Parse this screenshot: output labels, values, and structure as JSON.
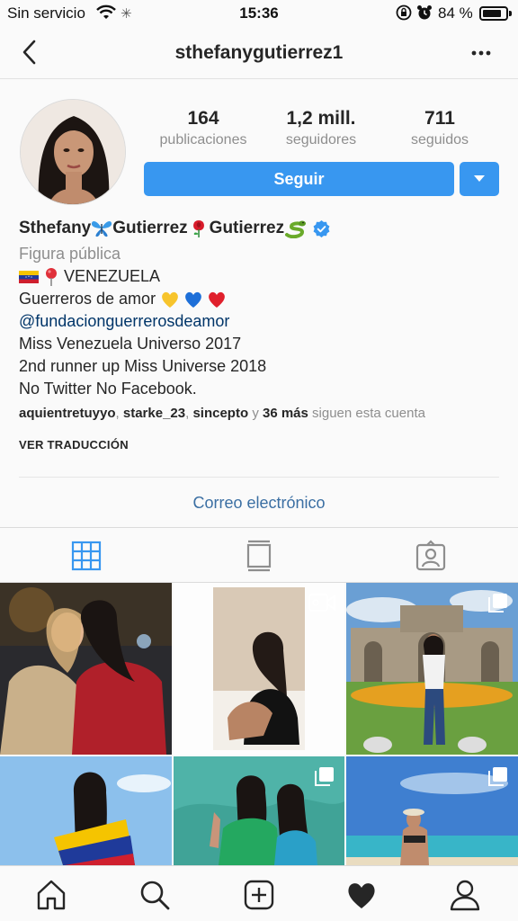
{
  "status_bar": {
    "carrier": "Sin servicio",
    "time": "15:36",
    "battery": "84 %",
    "battery_level": 0.84
  },
  "header": {
    "username": "sthefanygutierrez1",
    "back_icon": "chevron-left-icon",
    "more_icon": "more-horizontal-icon"
  },
  "profile": {
    "stats": [
      {
        "value": "164",
        "label": "publicaciones"
      },
      {
        "value": "1,2 mill.",
        "label": "seguidores"
      },
      {
        "value": "711",
        "label": "seguidos"
      }
    ],
    "follow_label": "Seguir",
    "accent_color": "#3897f0"
  },
  "bio": {
    "name_parts": [
      "Sthefany",
      "Gutierrez",
      "Gutierrez"
    ],
    "category": "Figura pública",
    "location": "VENEZUELA",
    "line_guerreros": "Guerreros de amor",
    "mention": "@fundacionguerrerosdeamor",
    "line_miss": "Miss Venezuela Universo 2017",
    "line_runner": "2nd runner up Miss Universe 2018",
    "line_social": "No Twitter No Facebook."
  },
  "followed_by": {
    "users": [
      "aquientretuyyo",
      "starke_23",
      "sincepto"
    ],
    "sep": ", ",
    "and": "y",
    "more": "36 más",
    "suffix": "siguen esta cuenta"
  },
  "translate_label": "VER TRADUCCIÓN",
  "contact_label": "Correo electrónico",
  "tabs": [
    {
      "icon": "grid-icon",
      "active": true
    },
    {
      "icon": "feed-icon",
      "active": false
    },
    {
      "icon": "tagged-icon",
      "active": false
    }
  ],
  "bottom_nav": [
    "home-icon",
    "search-icon",
    "new-post-icon",
    "activity-heart-icon",
    "profile-icon"
  ]
}
